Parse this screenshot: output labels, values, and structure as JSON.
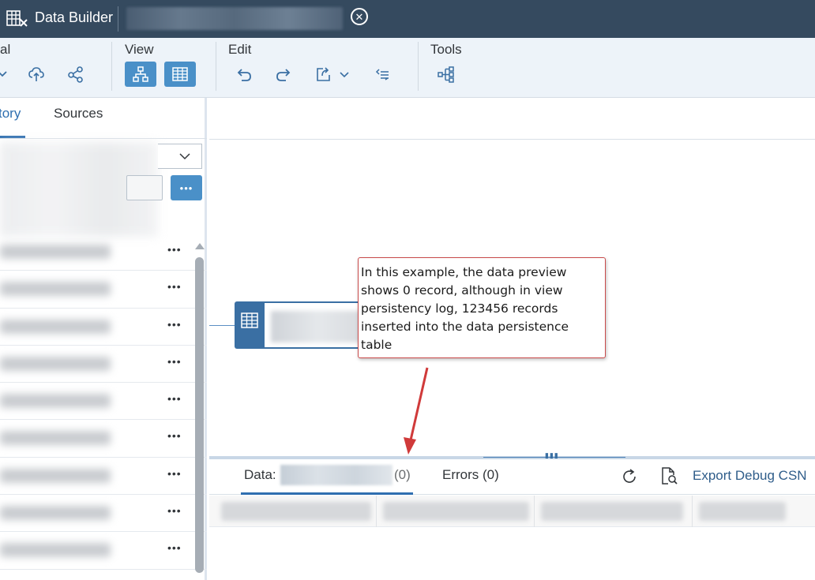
{
  "titlebar": {
    "app_icon": "data-builder-icon",
    "app_title": "Data Builder",
    "close_icon": "close-circle-icon"
  },
  "toolbar": {
    "groups": {
      "general": "al",
      "view": "View",
      "edit": "Edit",
      "tools": "Tools"
    },
    "icons": {
      "deploy": "cloud-upload-icon",
      "share": "share-icon",
      "diagram_view": "hierarchy-icon",
      "table_view": "table-grid-icon",
      "undo": "undo-icon",
      "redo": "redo-icon",
      "export": "export-icon",
      "expand": "chevron-down-icon",
      "indent": "indent-icon",
      "impact_lineage": "impact-lineage-icon"
    },
    "active_color": "#4a90c8"
  },
  "left_panel": {
    "tabs": [
      "tory",
      "Sources"
    ],
    "selected_tab": "tory",
    "more_label": "•••",
    "row_more_label": "•••",
    "row_count": 9
  },
  "canvas": {
    "node_icon": "table-grid-icon"
  },
  "annotation": {
    "text": "In this example, the data preview shows 0 record, although in view persistency log, 123456 records inserted into the data persistence table",
    "lines": [
      "In this example, the data preview",
      "shows 0 record, although in view",
      "persistency log, 123456 records",
      "inserted into the data persistence",
      "table"
    ],
    "border_color": "#c94a4a",
    "arrow_color": "#d03a3a"
  },
  "data_panel": {
    "data_tab_label": "Data:",
    "data_tab_count": "(0)",
    "errors_tab_label": "Errors (0)",
    "refresh_icon": "refresh-icon",
    "debug_icon": "inspect-document-icon",
    "export_label": "Export Debug CSN",
    "accent_color": "#2f6fb0"
  }
}
